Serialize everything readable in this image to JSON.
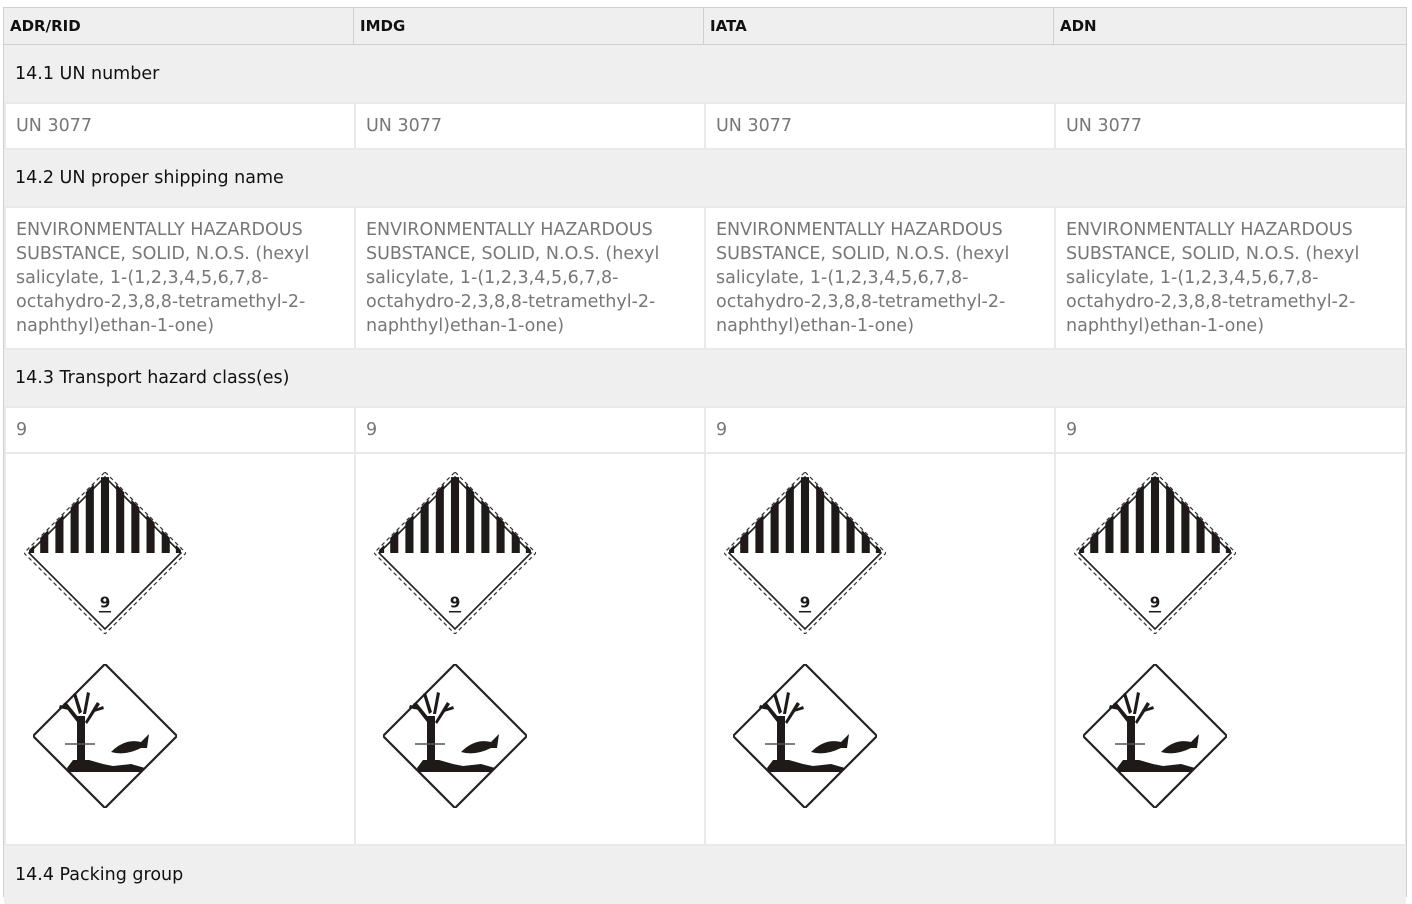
{
  "columns": [
    "ADR/RID",
    "IMDG",
    "IATA",
    "ADN"
  ],
  "sections": {
    "un_number": {
      "title": "14.1 UN number",
      "values": [
        "UN 3077",
        "UN 3077",
        "UN 3077",
        "UN 3077"
      ]
    },
    "shipping_name": {
      "title": "14.2 UN proper shipping name",
      "values": [
        "ENVIRONMENTALLY HAZARDOUS SUBSTANCE, SOLID, N.O.S. (hexyl salicylate, 1-(1,2,3,4,5,6,7,8-octahydro-2,3,8,8-tetramethyl-2-naphthyl)ethan-1-one)",
        "ENVIRONMENTALLY HAZARDOUS SUBSTANCE, SOLID, N.O.S. (hexyl salicylate, 1-(1,2,3,4,5,6,7,8-octahydro-2,3,8,8-tetramethyl-2-naphthyl)ethan-1-one)",
        "ENVIRONMENTALLY HAZARDOUS SUBSTANCE, SOLID, N.O.S. (hexyl salicylate, 1-(1,2,3,4,5,6,7,8-octahydro-2,3,8,8-tetramethyl-2-naphthyl)ethan-1-one)",
        "ENVIRONMENTALLY HAZARDOUS SUBSTANCE, SOLID, N.O.S. (hexyl salicylate, 1-(1,2,3,4,5,6,7,8-octahydro-2,3,8,8-tetramethyl-2-naphthyl)ethan-1-one)"
      ]
    },
    "hazard_class": {
      "title": "14.3 Transport hazard class(es)",
      "values": [
        "9",
        "9",
        "9",
        "9"
      ],
      "pictograms": [
        [
          "class-9-hazard-label-icon",
          "environmentally-hazardous-mark-icon"
        ],
        [
          "class-9-hazard-label-icon",
          "environmentally-hazardous-mark-icon"
        ],
        [
          "class-9-hazard-label-icon",
          "environmentally-hazardous-mark-icon"
        ],
        [
          "class-9-hazard-label-icon",
          "environmentally-hazardous-mark-icon"
        ]
      ]
    },
    "packing_group": {
      "title": "14.4 Packing group"
    }
  },
  "label_text": "9"
}
